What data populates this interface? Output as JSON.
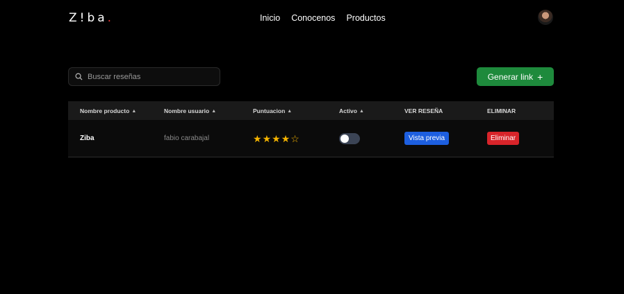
{
  "header": {
    "logo_main": "Z!ba",
    "logo_dot": ".",
    "nav": [
      "Inicio",
      "Conocenos",
      "Productos"
    ]
  },
  "search": {
    "placeholder": "Buscar reseñas",
    "value": ""
  },
  "actions": {
    "generate_label": "Generar link",
    "generate_icon": "+"
  },
  "table": {
    "headers": [
      "Nombre producto",
      "Nombre usuario",
      "Puntuacion",
      "Activo",
      "VER RESEÑA",
      "ELIMINAR"
    ],
    "rows": [
      {
        "producto": "Ziba",
        "usuario": "fabio carabajal",
        "rating": 4,
        "rating_max": 5,
        "activo": false,
        "ver_label": "Vista previa",
        "eliminar_label": "Eliminar"
      }
    ]
  },
  "colors": {
    "accent_green": "#1e8a3c",
    "preview_blue": "#1d5fe0",
    "delete_red": "#d8242a",
    "star": "#f5b400"
  }
}
